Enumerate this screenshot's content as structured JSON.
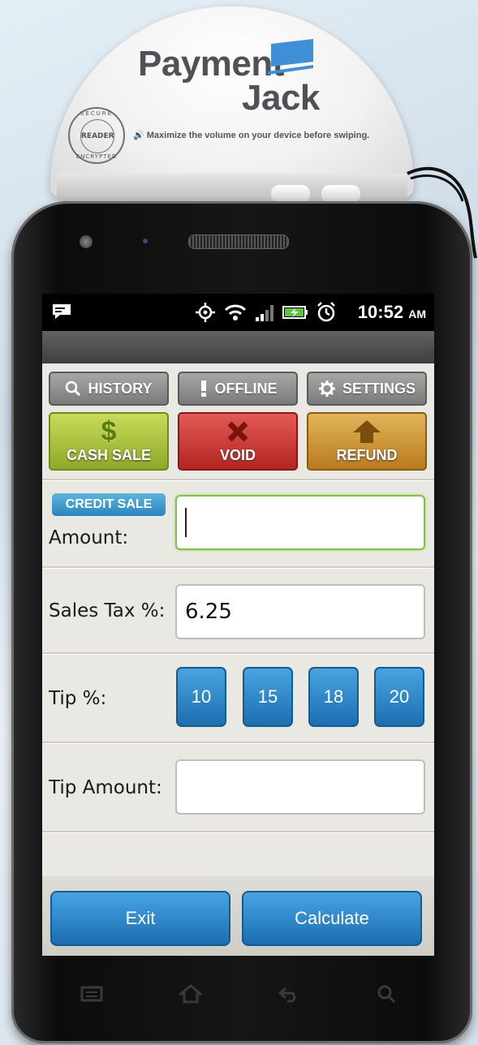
{
  "reader": {
    "brand_line1": "Payment",
    "brand_line2": "Jack",
    "seal_top": "SECURE",
    "seal_center": "READER",
    "seal_bottom": "ENCRYPTED",
    "notice": "Maximize the volume on your device before swiping."
  },
  "statusbar": {
    "time": "10:52",
    "ampm": "AM",
    "icons": [
      "message-icon",
      "gps-icon",
      "wifi-icon",
      "signal-icon",
      "battery-charging-icon",
      "alarm-icon"
    ]
  },
  "toolbar": {
    "history_label": "HISTORY",
    "offline_label": "OFFLINE",
    "settings_label": "SETTINGS"
  },
  "actions": {
    "cash_sale_label": "CASH SALE",
    "void_label": "VOID",
    "refund_label": "REFUND"
  },
  "form": {
    "credit_sale_badge": "CREDIT SALE",
    "amount_label": "Amount:",
    "amount_value": "",
    "sales_tax_label": "Sales Tax %:",
    "sales_tax_value": "6.25",
    "tip_label": "Tip %:",
    "tip_options": [
      "10",
      "15",
      "18",
      "20"
    ],
    "tip_amount_label": "Tip Amount:",
    "tip_amount_value": ""
  },
  "footer": {
    "exit_label": "Exit",
    "calculate_label": "Calculate"
  },
  "colors": {
    "accent_blue": "#2a85bd",
    "cash_green": "#8ea929",
    "void_red": "#b42420",
    "refund_orange": "#b97b1e",
    "focus_green": "#7fbf4a"
  }
}
